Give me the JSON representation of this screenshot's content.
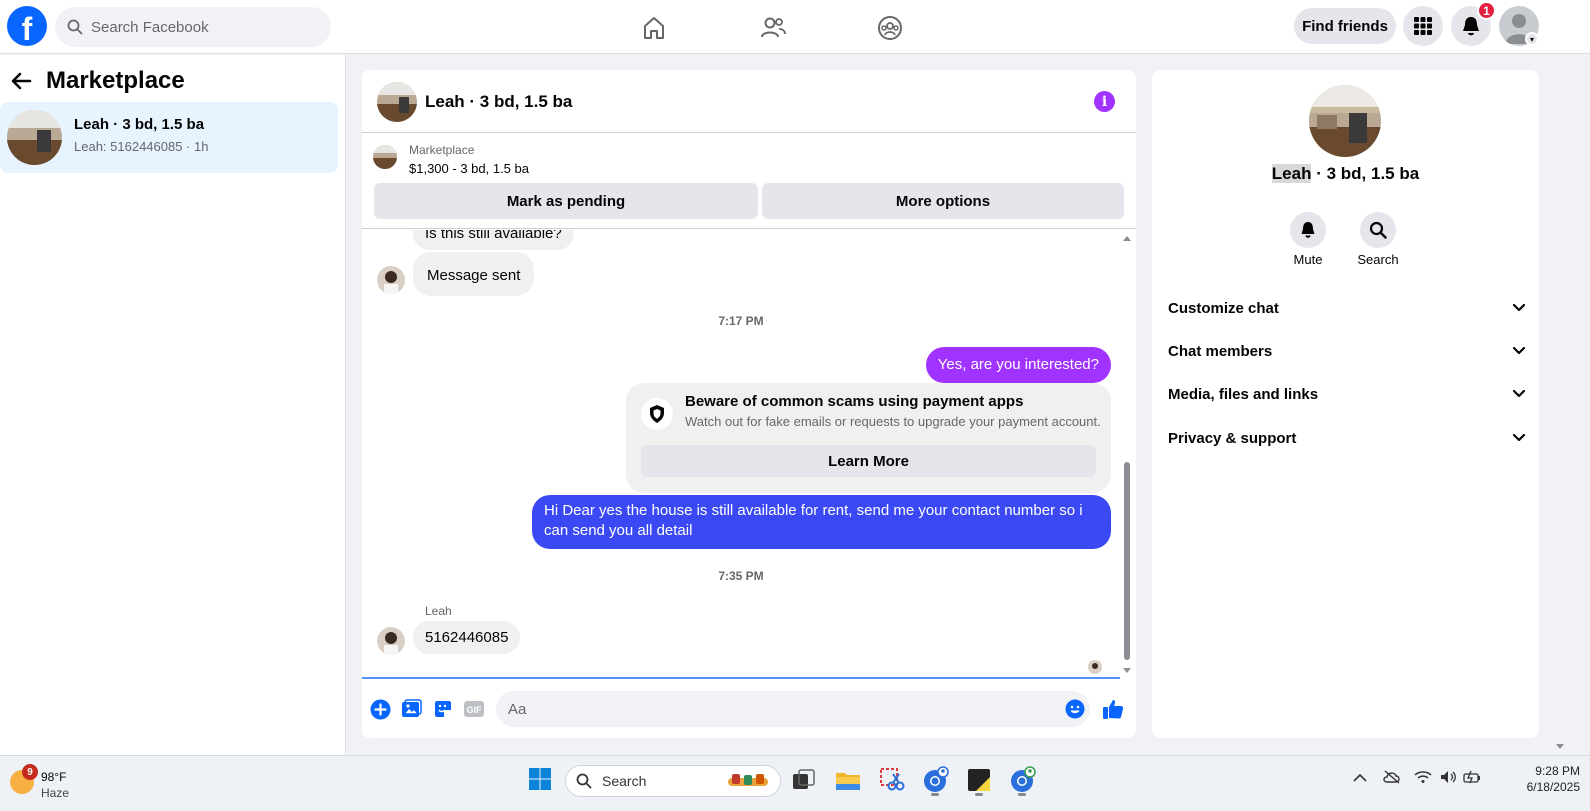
{
  "topbar": {
    "logo_letter": "f",
    "search_placeholder": "Search Facebook",
    "find_friends": "Find friends",
    "notif_count": "1"
  },
  "sidebar": {
    "title": "Marketplace",
    "conversations": [
      {
        "title": "Leah · 3 bd, 1.5 ba",
        "subtitle": "Leah: 5162446085 · 1h"
      }
    ]
  },
  "chat": {
    "header_name": "Leah · 3 bd, 1.5 ba",
    "listing": {
      "label": "Marketplace",
      "price_line": "$1,300 - 3 bd, 1.5 ba",
      "mark_pending": "Mark as pending",
      "more_options": "More options"
    },
    "messages": {
      "partial_top": "Is this still available?",
      "msg_sent": "Message sent",
      "time1": "7:17 PM",
      "out1": "Yes, are you interested?",
      "scam_title": "Beware of common scams using payment apps",
      "scam_sub": "Watch out for fake emails or requests to upgrade your payment account.",
      "learn_more": "Learn More",
      "out2": "Hi Dear yes the house is still available for rent, send me your contact number so i can send you all detail",
      "time2": "7:35 PM",
      "sender": "Leah",
      "in_last": "5162446085"
    },
    "composer_placeholder": "Aa",
    "colors": {
      "out1": "#a033ff",
      "out2": "#3b49f5",
      "accent": "#0866ff"
    }
  },
  "right_panel": {
    "name_first": "Leah",
    "name_rest": " · 3 bd, 1.5 ba",
    "mute": "Mute",
    "search": "Search",
    "rows": [
      "Customize chat",
      "Chat members",
      "Media, files and links",
      "Privacy & support"
    ]
  },
  "taskbar": {
    "weather_badge": "9",
    "temp": "98°F",
    "condition": "Haze",
    "search": "Search",
    "time": "9:28 PM",
    "date": "6/18/2025"
  }
}
